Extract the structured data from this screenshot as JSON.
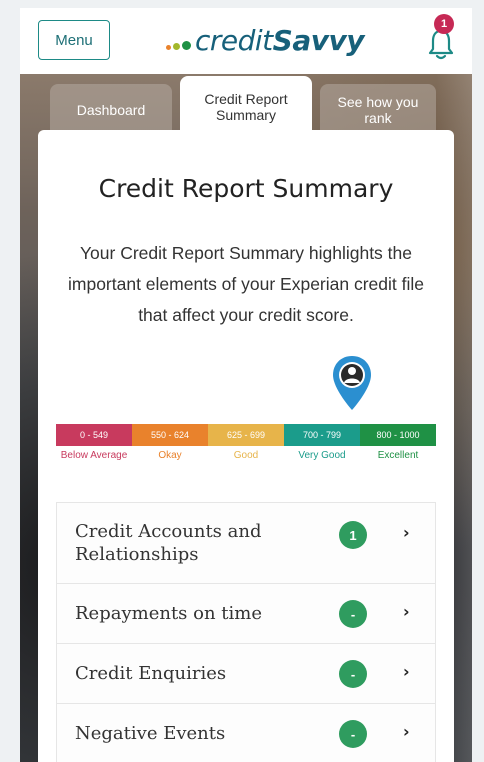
{
  "header": {
    "menu_label": "Menu",
    "logo_credit": "credit",
    "logo_savvy": "Savvy",
    "notification_count": "1"
  },
  "tabs": [
    {
      "label": "Dashboard"
    },
    {
      "label": "Credit Report Summary"
    },
    {
      "label": "See how you rank"
    }
  ],
  "main": {
    "title": "Credit Report Summary",
    "description": "Your Credit Report Summary highlights the important elements of your Experian credit file that affect your credit score."
  },
  "score_scale": {
    "segments": [
      {
        "range": "0 - 549",
        "label": "Below Average",
        "color": "#c83a5e",
        "label_color": "#c83a5e"
      },
      {
        "range": "550 - 624",
        "label": "Okay",
        "color": "#e9822c",
        "label_color": "#e9822c"
      },
      {
        "range": "625 - 699",
        "label": "Good",
        "color": "#e7b44a",
        "label_color": "#e7b44a"
      },
      {
        "range": "700 - 799",
        "label": "Very Good",
        "color": "#1b9c8b",
        "label_color": "#1b9c8b"
      },
      {
        "range": "800 - 1000",
        "label": "Excellent",
        "color": "#1f9145",
        "label_color": "#1f9145"
      }
    ],
    "marker_band": "700 - 799"
  },
  "sections": [
    {
      "label": "Credit Accounts and Relationships",
      "badge": "1"
    },
    {
      "label": "Repayments on time",
      "badge": "-"
    },
    {
      "label": "Credit Enquiries",
      "badge": "-"
    },
    {
      "label": "Negative Events",
      "badge": "-"
    }
  ],
  "colors": {
    "brand": "#17607a",
    "accent": "#1d8a86",
    "badge_green": "#2f9c5f",
    "alert": "#c62955"
  }
}
